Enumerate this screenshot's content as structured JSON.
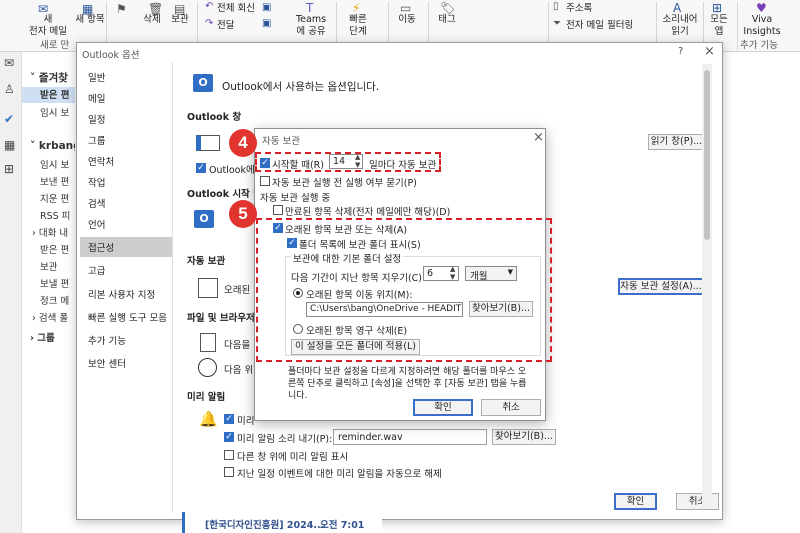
{
  "ribbon": {
    "new_mail": "새\n전자 메일",
    "new_items": "새 항목",
    "delete": "삭제",
    "archive": "보관",
    "reply_all": "전체 회신",
    "forward": "전달",
    "teams_share": "Teams\n에 공유",
    "quick_steps": "빠른\n단계",
    "move": "이동",
    "tags": "태그",
    "address_book": "주소록",
    "filter_email": "전자 메일 필터링",
    "read_aloud": "소리내어\n읽기",
    "all_apps": "모든\n앱",
    "viva": "Viva\nInsights",
    "group_new": "새로 만",
    "group_addins": "추가 기능"
  },
  "folders": {
    "favorites": "즐겨찾",
    "inbox": "받은 편",
    "drafts": "임시 보",
    "account": "krbang",
    "items": [
      "임시 보",
      "보낸 편",
      "지운 편",
      "RSS 피",
      "대화 내",
      "받은 편",
      "보관",
      "보낼 편",
      "정크 메",
      "검색 폴"
    ],
    "groups": "그룹"
  },
  "options": {
    "title": "Outlook 옵션",
    "help": "?",
    "close": "×",
    "nav": [
      "일반",
      "메일",
      "일정",
      "그룹",
      "연락처",
      "작업",
      "검색",
      "언어",
      "접근성",
      "고급",
      "리본 사용자 지정",
      "빠른 실행 도구 모음",
      "추가 기능",
      "보안 센터"
    ],
    "header": "Outlook에서 사용하는 옵션입니다.",
    "sec_panes": "Outlook 창",
    "pane_check": "Outlook에",
    "reading_pane_btn": "읽기 창(P)...",
    "sec_start": "Outlook 시작 및 종",
    "sec_autoarchive": "자동 보관",
    "aa_desc": "오래된",
    "aa_settings_btn": "자동 보관 설정(A)...",
    "sec_files": "파일 및 브라우저",
    "files_text": "다음을",
    "browser_text": "다음 위",
    "sec_reminders": "미리 알림",
    "rem_show": "미리",
    "rem_sound": "미리 알림 소리 내기(P):",
    "rem_sound_file": "reminder.wav",
    "rem_browse": "찾아보기(B)...",
    "rem_top": "다른 창 위에 미리 알림 표시",
    "rem_past": "지난 일정 이벤트에 대한 미리 알림을 자동으로 해제",
    "ok": "확인",
    "cancel": "취소",
    "bg_mail_from": "[한국디자인진흥원] 2024...",
    "bg_mail_time": "오전 7:01"
  },
  "autoarchive": {
    "title": "자동 보관",
    "close": "×",
    "run_every_label": "시작할 때(R)",
    "run_every_days": "14",
    "run_every_suffix": "일마다 자동 보관",
    "prompt": "자동 보관 실행 전 실행 여부 묻기(P)",
    "during_label": "자동 보관 실행 중",
    "delete_expired": "만료된 항목 삭제(전자 메일에만 해당)(D)",
    "archive_old": "오래된 항목 보관 또는 삭제(A)",
    "show_folder": "폴더 목록에 보관 폴더 표시(S)",
    "default_group": "보관에 대한 기본 폴더 설정",
    "clean_older": "다음 기간이 지난 항목 지우기(C):",
    "clean_months": "6",
    "months_unit": "개월",
    "move_old": "오래된 항목 이동 위치(M):",
    "move_path": "C:\\Users\\bang\\OneDrive - HEADIT Inc",
    "browse": "찾아보기(B)...",
    "perm_delete": "오래된 항목 영구 삭제(E)",
    "apply_all": "이 설정을 모든 폴더에 적용(L)",
    "note": "폴더마다 보관 설정을 다르게 지정하려면 해당 폴더를 마우스 오른쪽 단추로 클릭하고 [속성]을 선택한 후 [자동 보관] 탭을 누릅니다.",
    "ok": "확인",
    "cancel": "취소"
  },
  "badges": {
    "step4": "4",
    "step5": "5"
  },
  "colors": {
    "accent": "#2f6ec4",
    "highlight_red": "#d9202a",
    "badge_red": "#e2342e"
  }
}
